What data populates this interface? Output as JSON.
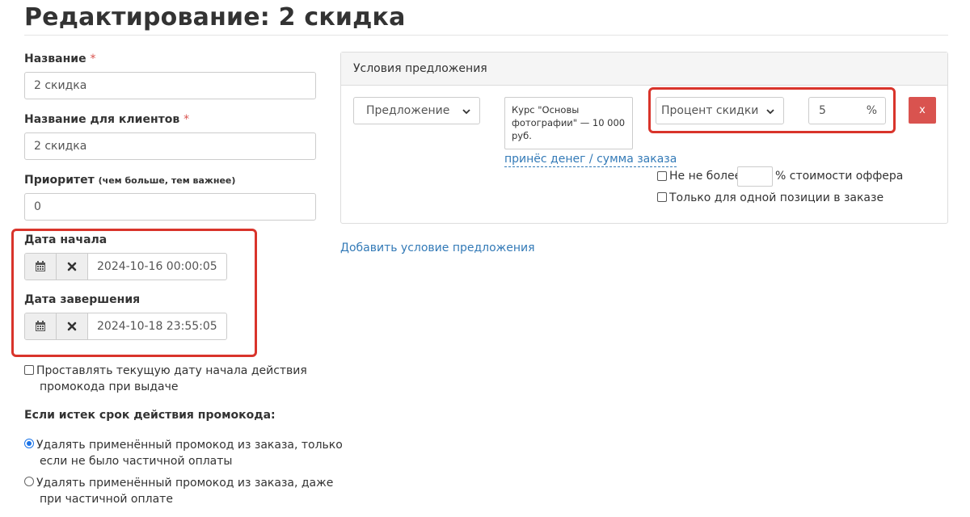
{
  "page": {
    "title": "Редактирование: 2 скидка"
  },
  "form": {
    "name": {
      "label": "Название",
      "required_mark": "*",
      "value": "2 скидка"
    },
    "client_name": {
      "label": "Название для клиентов",
      "required_mark": "*",
      "value": "2 скидка"
    },
    "priority": {
      "label": "Приоритет",
      "hint": "(чем больше, тем важнее)",
      "value": "0"
    },
    "start_date": {
      "label": "Дата начала",
      "value": "2024-10-16 00:00:05"
    },
    "end_date": {
      "label": "Дата завершения",
      "value": "2024-10-18 23:55:05"
    },
    "set_current_date": {
      "line1": "Проставлять текущую дату начала действия",
      "line2": "промокода при выдаче",
      "checked": false
    },
    "expired": {
      "label": "Если истек срок действия промокода:",
      "options": [
        {
          "line1": "Удалять применённый промокод из заказа, только",
          "line2": "если не было частичной оплаты",
          "checked": true
        },
        {
          "line1": "Удалять применённый промокод из заказа, даже",
          "line2": "при частичной оплате",
          "checked": false
        }
      ]
    }
  },
  "conditions": {
    "header": "Условия предложения",
    "type_select": "Предложение",
    "offer_text": "Курс \"Основы фотографии\" — 10 000 руб.",
    "discount_type_select": "Процент скидки",
    "discount_value": "5",
    "discount_unit": "%",
    "remove_label": "x",
    "revenue_link": "принёс денег / сумма заказа",
    "max_percent": {
      "label_before": "Не не более",
      "label_after": "% стоимости оффера",
      "value": "",
      "checked": false
    },
    "single_position": {
      "label": "Только для одной позиции в заказе",
      "checked": false
    },
    "add_condition_link": "Добавить условие предложения"
  },
  "colors": {
    "highlight": "#d9342b",
    "link": "#337ab7",
    "danger": "#d9534f",
    "radio": "#1a73e8"
  }
}
